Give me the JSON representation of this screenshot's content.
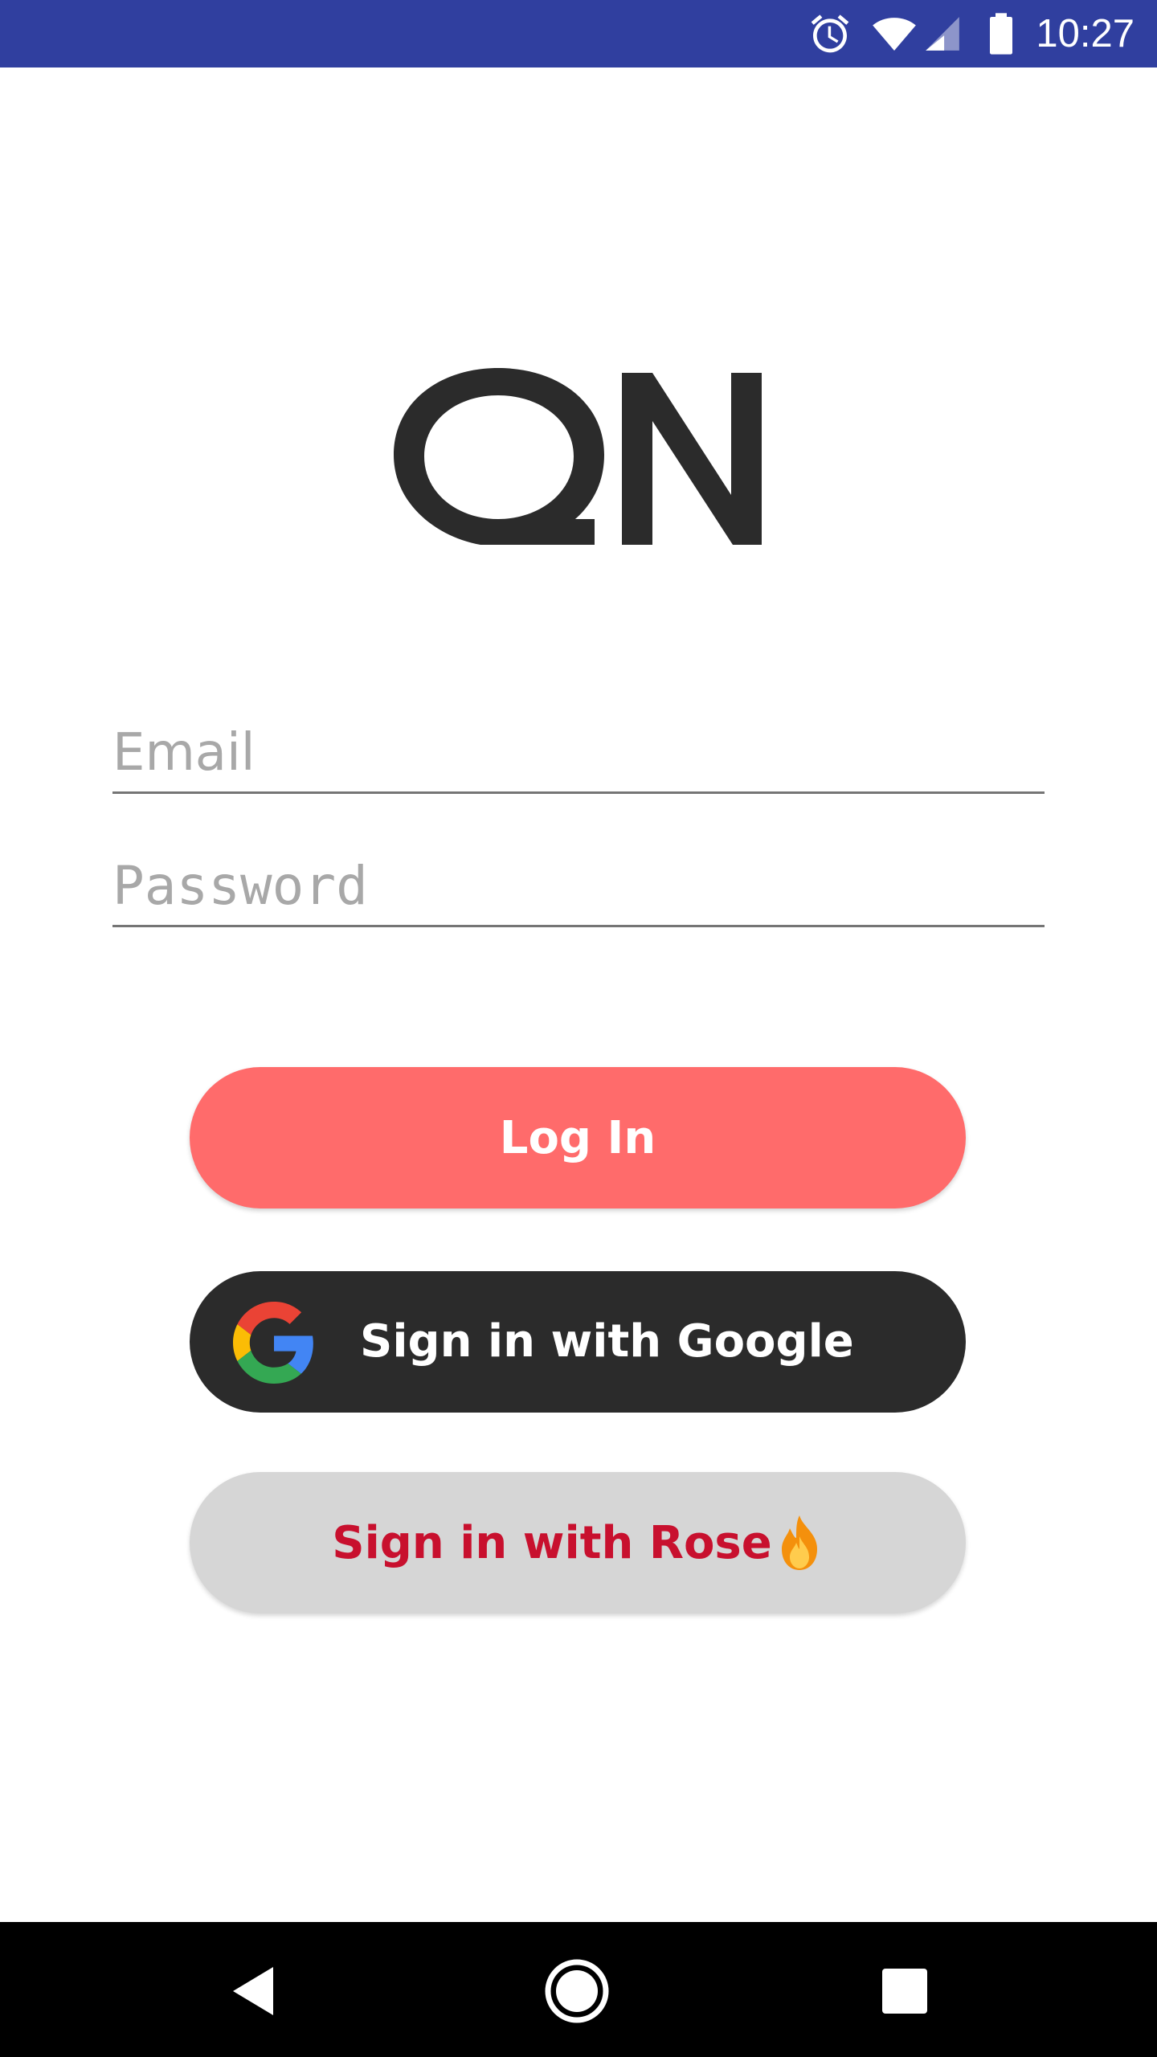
{
  "status_bar": {
    "time": "10:27",
    "icons": [
      "alarm-icon",
      "wifi-icon",
      "cell-signal-icon",
      "battery-icon"
    ],
    "background": "#303F9F"
  },
  "logo": {
    "text": "QN"
  },
  "form": {
    "email_placeholder": "Email",
    "email_value": "",
    "password_placeholder": "Password",
    "password_value": ""
  },
  "buttons": {
    "login_label": "Log In",
    "google_label": "Sign in with Google",
    "rose_label": "Sign in with Rose"
  },
  "colors": {
    "login_button": "#FF6B6B",
    "google_button": "#2B2B2B",
    "rose_button": "#D6D6D6",
    "rose_text": "#C8102E"
  },
  "nav_bar": {
    "icons": [
      "back-icon",
      "home-icon",
      "recents-icon"
    ]
  }
}
